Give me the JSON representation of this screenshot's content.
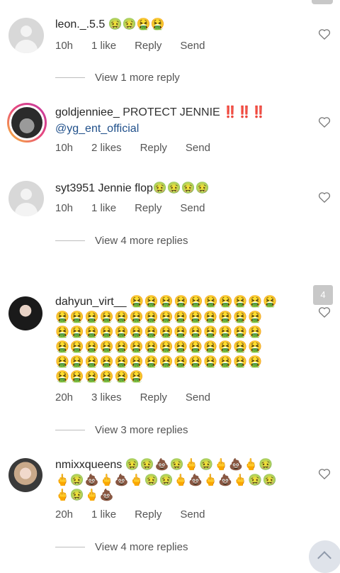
{
  "comments": [
    {
      "username": "leon._.5.5",
      "text": "",
      "emoji_line": "🤢🤢🤮🤮",
      "time": "10h",
      "likes": "1 like",
      "reply": "Reply",
      "send": "Send",
      "more": "View 1 more reply"
    },
    {
      "username": "goldjenniee_",
      "text": "PROTECT JENNIE ‼️‼️‼️",
      "mention": "@yg_ent_official",
      "time": "10h",
      "likes": "2 likes",
      "reply": "Reply",
      "send": "Send"
    },
    {
      "username": "syt3951",
      "text": "Jennie flop",
      "emoji_line": "🤢🤢🤢🤢",
      "time": "10h",
      "likes": "1 like",
      "reply": "Reply",
      "send": "Send",
      "more": "View 4 more replies"
    },
    {
      "username": "dahyun_virt__",
      "emoji_first": "🤮🤮🤮🤮🤮🤮🤮🤮🤮🤮",
      "emoji_rows": [
        "🤮🤮🤮🤮🤮🤮🤮🤮🤮🤮🤮🤮🤮🤮",
        "🤮🤮🤮🤮🤮🤮🤮🤮🤮🤮🤮🤮🤮🤮",
        "🤮🤮🤮🤮🤮🤮🤮🤮🤮🤮🤮🤮🤮🤮",
        "🤮🤮🤮🤮🤮🤮🤮🤮🤮🤮🤮🤮🤮🤮",
        "🤮🤮🤮🤮🤮🤮"
      ],
      "time": "20h",
      "likes": "3 likes",
      "reply": "Reply",
      "send": "Send",
      "more": "View 3 more replies",
      "badge": "4"
    },
    {
      "username": "nmixxqueens",
      "emoji_first": "🤢🤢💩🤢🖕🤢🖕💩🖕🤢",
      "emoji_rows": [
        "🖕🤢💩🖕💩🖕🤢🤢🖕💩🖕💩🖕🤢🤢",
        "🖕🤢🖕💩"
      ],
      "time": "20h",
      "likes": "1 like",
      "reply": "Reply",
      "send": "Send",
      "more": "View 4 more replies"
    }
  ]
}
